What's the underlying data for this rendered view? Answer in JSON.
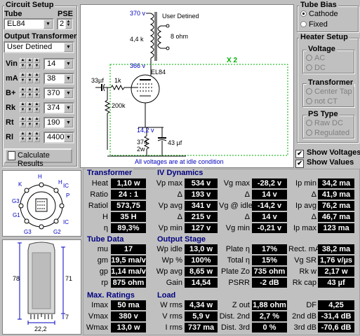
{
  "circuit_setup": {
    "title": "Circuit Setup",
    "tube_label": "Tube",
    "tube_value": "EL84",
    "pse_label": "PSE",
    "pse_value": "2",
    "ot_label": "Output Transformer",
    "ot_value": "User Detined",
    "params": [
      {
        "label": "Vin",
        "value": "14"
      },
      {
        "label": "mA",
        "value": "38"
      },
      {
        "label": "B+",
        "value": "370"
      },
      {
        "label": "Rk",
        "value": "374"
      },
      {
        "label": "Rt",
        "value": "190"
      },
      {
        "label": "Rl",
        "value": "4400"
      }
    ],
    "calc_button": "Calculate Results"
  },
  "schematic": {
    "b_plus": "370 v",
    "transformer": "User Detined",
    "primary": "4,4 k",
    "secondary": "8 ohm",
    "multiplier": "X 2",
    "plate_v": "366 v",
    "tube": "EL84",
    "coupling_cap": "33µf",
    "grid_res": "1k",
    "grid_leak": "200k",
    "cathode_v": "14,2 v",
    "cathode_res": "374",
    "cathode_res_w": "2w",
    "cathode_cap": "43 µf",
    "note": "All voltages are at idle condition"
  },
  "tube_bias": {
    "title": "Tube Bias",
    "options": [
      "Cathode",
      "Fixed"
    ],
    "selected": "Cathode"
  },
  "heater_setup": {
    "title": "Heater Setup",
    "voltage_title": "Voltage",
    "voltage_options": [
      "AC",
      "DC"
    ],
    "transformer_title": "Transformer",
    "transformer_options": [
      "Center Tap",
      "not CT"
    ],
    "ps_title": "PS Type",
    "ps_options": [
      "Raw DC",
      "Regulated"
    ]
  },
  "checks": {
    "show_voltages": "Show Voltages",
    "show_values": "Show Values"
  },
  "pinout": {
    "labels": [
      "H",
      "H",
      "K",
      "G3",
      "IC",
      "P",
      "G1",
      "IC",
      "G3",
      "G2"
    ]
  },
  "dimensions": {
    "height_total": "78",
    "height_body": "71",
    "base": "7",
    "diameter": "22,2"
  },
  "transformer_data": {
    "title": "Transformer",
    "rows": [
      {
        "label": "Heat",
        "value": "1,10 w"
      },
      {
        "label": "Ratio",
        "value": "24 : 1"
      },
      {
        "label": "Ratiol",
        "value": "573,75"
      },
      {
        "label": "H",
        "value": "35 H"
      },
      {
        "label": "η",
        "value": "89,3%"
      }
    ]
  },
  "iv_dynamics": {
    "title": "IV Dynamics",
    "rows": [
      [
        {
          "label": "Vp max",
          "value": "534 v"
        },
        {
          "label": "Vg max",
          "value": "-28,2 v"
        },
        {
          "label": "Ip min",
          "value": "34,2 ma"
        }
      ],
      [
        {
          "label": "Δ",
          "value": "193 v"
        },
        {
          "label": "Δ",
          "value": "14 v"
        },
        {
          "label": "Δ",
          "value": "41,9 ma"
        }
      ],
      [
        {
          "label": "Vp avg",
          "value": "341 v"
        },
        {
          "label": "Vg @ idle",
          "value": "-14,2 v"
        },
        {
          "label": "Ip avg",
          "value": "76,2 ma"
        }
      ],
      [
        {
          "label": "Δ",
          "value": "215 v"
        },
        {
          "label": "Δ",
          "value": "14 v"
        },
        {
          "label": "Δ",
          "value": "46,7 ma"
        }
      ],
      [
        {
          "label": "Vp min",
          "value": "127 v"
        },
        {
          "label": "Vg min",
          "value": "-0,21 v"
        },
        {
          "label": "Ip max",
          "value": "123 ma"
        }
      ]
    ]
  },
  "tube_data": {
    "title": "Tube Data",
    "rows": [
      {
        "label": "mu",
        "value": "17"
      },
      {
        "label": "gm",
        "value": "19,5 ma/v"
      },
      {
        "label": "gp",
        "value": "1,14 ma/v"
      },
      {
        "label": "rp",
        "value": "875 ohm"
      }
    ]
  },
  "output_stage": {
    "title": "Output Stage",
    "rows": [
      [
        {
          "label": "Wp idle",
          "value": "13,0 w"
        },
        {
          "label": "Plate η",
          "value": "17%"
        },
        {
          "label": "Rect. mA",
          "value": "38,2 ma"
        }
      ],
      [
        {
          "label": "Wp %",
          "value": "100%"
        },
        {
          "label": "Total η",
          "value": "15%"
        },
        {
          "label": "Vg SR",
          "value": "1,76 v/µs"
        }
      ],
      [
        {
          "label": "Wp avg",
          "value": "8,65 w"
        },
        {
          "label": "Plate Zo",
          "value": "735 ohm"
        },
        {
          "label": "Rk w",
          "value": "2,17 w"
        }
      ],
      [
        {
          "label": "Gain",
          "value": "14,54"
        },
        {
          "label": "PSRR",
          "value": "-2 dB"
        },
        {
          "label": "Rk cap",
          "value": "43 µf"
        }
      ]
    ]
  },
  "max_ratings": {
    "title": "Max. Ratings",
    "rows": [
      {
        "label": "Imax",
        "value": "50 ma"
      },
      {
        "label": "Vmax",
        "value": "380 v"
      },
      {
        "label": "Wmax",
        "value": "13,0 w"
      }
    ]
  },
  "load": {
    "title": "Load",
    "rows": [
      [
        {
          "label": "W rms",
          "value": "4,34 w"
        },
        {
          "label": "Z out",
          "value": "1,88 ohm"
        },
        {
          "label": "DF",
          "value": "4,25"
        }
      ],
      [
        {
          "label": "V rms",
          "value": "5,9 v"
        },
        {
          "label": "Dist. 2nd",
          "value": "2,7 %"
        },
        {
          "label": "2nd dB",
          "value": "-31,4 dB"
        }
      ],
      [
        {
          "label": "I rms",
          "value": "737 ma"
        },
        {
          "label": "Dist. 3rd",
          "value": "0 %"
        },
        {
          "label": "3rd dB",
          "value": "-70,6 dB"
        }
      ]
    ]
  }
}
